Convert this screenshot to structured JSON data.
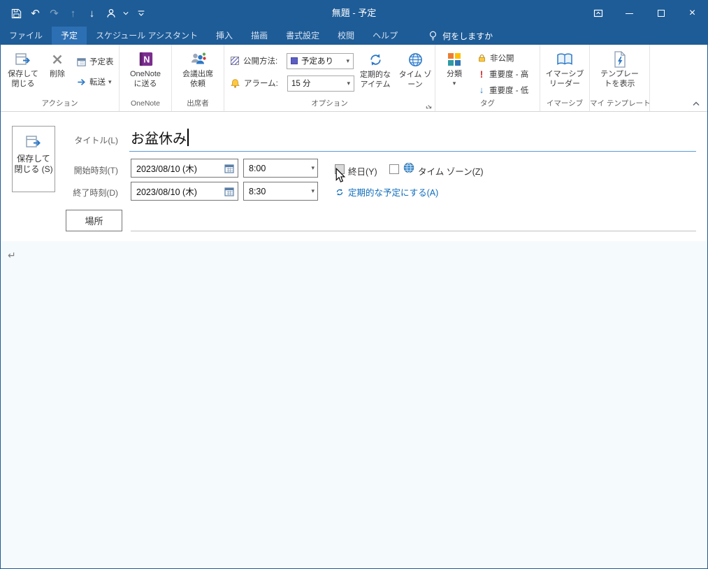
{
  "titlebar": {
    "title": "無題 - 予定"
  },
  "icons": {
    "undo": "↶",
    "redo": "↷",
    "previous_item": "↑",
    "next_item": "↓",
    "dropdown": "▾",
    "close": "×",
    "high_importance": "!",
    "low_importance": "↓"
  },
  "tabs": [
    {
      "label": "ファイル",
      "active": false
    },
    {
      "label": "予定",
      "active": true
    },
    {
      "label": "スケジュール アシスタント",
      "active": false
    },
    {
      "label": "挿入",
      "active": false
    },
    {
      "label": "描画",
      "active": false
    },
    {
      "label": "書式設定",
      "active": false
    },
    {
      "label": "校閲",
      "active": false
    },
    {
      "label": "ヘルプ",
      "active": false
    }
  ],
  "tellme": {
    "label": "何をしますか"
  },
  "ribbon": {
    "groups": {
      "actions": {
        "label": "アクション",
        "save_close": "保存して閉じる",
        "delete": "削除",
        "calendar": "予定表",
        "forward": "転送"
      },
      "onenote": {
        "label": "OneNote",
        "send": "OneNote に送る"
      },
      "attendees": {
        "label": "出席者",
        "invite": "会議出席依頼"
      },
      "options": {
        "label": "オプション",
        "show_as_label": "公開方法:",
        "show_as_value": "予定あり",
        "reminder_label": "アラーム:",
        "reminder_value": "15 分",
        "recurrence": "定期的なアイテム",
        "timezone": "タイム ゾーン"
      },
      "tags": {
        "label": "タグ",
        "categorize": "分類",
        "private": "非公開",
        "high": "重要度 - 高",
        "low": "重要度 - 低"
      },
      "immersive": {
        "label": "イマーシブ",
        "reader": "イマーシブリーダー"
      },
      "templates": {
        "label": "マイ テンプレート",
        "view": "テンプレートを表示"
      }
    }
  },
  "form": {
    "save_close": "保存して閉じる (S)",
    "title_label": "タイトル(L)",
    "title_value": "お盆休み",
    "start_label": "開始時刻(T)",
    "start_date": "2023/08/10 (木)",
    "start_time": "8:00",
    "all_day": "終日(Y)",
    "timezone": "タイム ゾーン(Z)",
    "end_label": "終了時刻(D)",
    "end_date": "2023/08/10 (木)",
    "end_time": "8:30",
    "recurrence_link": "定期的な予定にする(A)",
    "location": "場所"
  },
  "editor": {
    "return_mark": "↵"
  }
}
